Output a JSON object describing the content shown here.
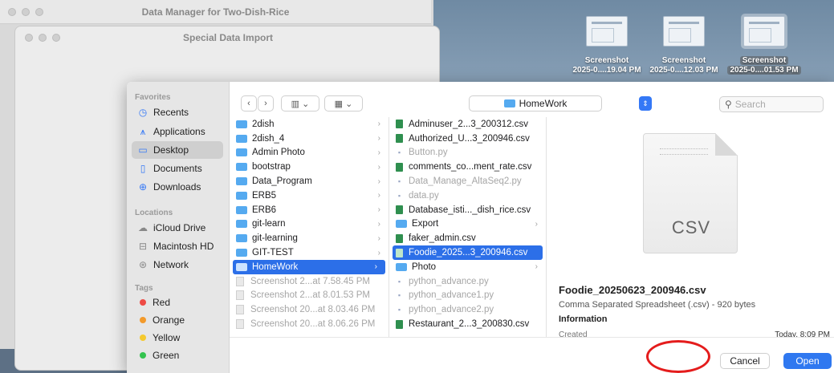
{
  "desktop": {
    "screenshots": [
      {
        "line1": "Screenshot",
        "line2": "2025-0....19.04 PM"
      },
      {
        "line1": "Screenshot",
        "line2": "2025-0....12.03 PM"
      },
      {
        "line1": "Screenshot",
        "line2": "2025-0....01.53 PM"
      }
    ]
  },
  "back_window": {
    "title": "Data Manager for Two-Dish-Rice"
  },
  "import_window": {
    "title": "Special Data Import"
  },
  "sidebar": {
    "favorites_label": "Favorites",
    "favorites": [
      {
        "label": "Recents",
        "icon": "clock-icon"
      },
      {
        "label": "Applications",
        "icon": "applications-icon"
      },
      {
        "label": "Desktop",
        "icon": "desktop-icon"
      },
      {
        "label": "Documents",
        "icon": "document-icon"
      },
      {
        "label": "Downloads",
        "icon": "download-icon"
      }
    ],
    "locations_label": "Locations",
    "locations": [
      {
        "label": "iCloud Drive",
        "icon": "cloud-icon"
      },
      {
        "label": "Macintosh HD",
        "icon": "disk-icon"
      },
      {
        "label": "Network",
        "icon": "network-icon"
      }
    ],
    "tags_label": "Tags",
    "tags": [
      {
        "label": "Red",
        "color": "#ee4b45"
      },
      {
        "label": "Orange",
        "color": "#f39a2b"
      },
      {
        "label": "Yellow",
        "color": "#f5c92e"
      },
      {
        "label": "Green",
        "color": "#34c34f"
      }
    ]
  },
  "toolbar": {
    "location": "HomeWork",
    "search_placeholder": "Search"
  },
  "column1": [
    {
      "name": "2dish",
      "kind": "folder"
    },
    {
      "name": "2dish_4",
      "kind": "folder"
    },
    {
      "name": "Admin Photo",
      "kind": "folder"
    },
    {
      "name": "bootstrap",
      "kind": "folder"
    },
    {
      "name": "Data_Program",
      "kind": "folder"
    },
    {
      "name": "ERB5",
      "kind": "folder"
    },
    {
      "name": "ERB6",
      "kind": "folder"
    },
    {
      "name": "git-learn",
      "kind": "folder"
    },
    {
      "name": "git-learning",
      "kind": "folder"
    },
    {
      "name": "GIT-TEST",
      "kind": "folder"
    },
    {
      "name": "HomeWork",
      "kind": "folder"
    },
    {
      "name": "Screenshot 2...at 7.58.45 PM",
      "kind": "image"
    },
    {
      "name": "Screenshot 2...at 8.01.53 PM",
      "kind": "image"
    },
    {
      "name": "Screenshot 20...at 8.03.46 PM",
      "kind": "image"
    },
    {
      "name": "Screenshot 20...at 8.06.26 PM",
      "kind": "image"
    }
  ],
  "column2": [
    {
      "name": "Adminuser_2...3_200312.csv",
      "kind": "csv"
    },
    {
      "name": "Authorized_U...3_200946.csv",
      "kind": "csv"
    },
    {
      "name": "Button.py",
      "kind": "py"
    },
    {
      "name": "comments_co...ment_rate.csv",
      "kind": "csv"
    },
    {
      "name": "Data_Manage_AltaSeq2.py",
      "kind": "py"
    },
    {
      "name": "data.py",
      "kind": "py"
    },
    {
      "name": "Database_isti..._dish_rice.csv",
      "kind": "csv"
    },
    {
      "name": "Export",
      "kind": "folder"
    },
    {
      "name": "faker_admin.csv",
      "kind": "csv"
    },
    {
      "name": "Foodie_2025...3_200946.csv",
      "kind": "csv"
    },
    {
      "name": "Photo",
      "kind": "folder"
    },
    {
      "name": "python_advance.py",
      "kind": "py"
    },
    {
      "name": "python_advance1.py",
      "kind": "py"
    },
    {
      "name": "python_advance2.py",
      "kind": "py"
    },
    {
      "name": "Restaurant_2...3_200830.csv",
      "kind": "csv"
    }
  ],
  "preview": {
    "ext_label": "CSV",
    "filename": "Foodie_20250623_200946.csv",
    "kind": "Comma Separated Spreadsheet (.csv) - 920 bytes",
    "info_label": "Information",
    "created_label": "Created",
    "created_value": "Today, 8:09 PM"
  },
  "buttons": {
    "cancel": "Cancel",
    "open": "Open"
  },
  "colors": {
    "accent": "#2f78f0",
    "annotation": "#e41c1c"
  }
}
